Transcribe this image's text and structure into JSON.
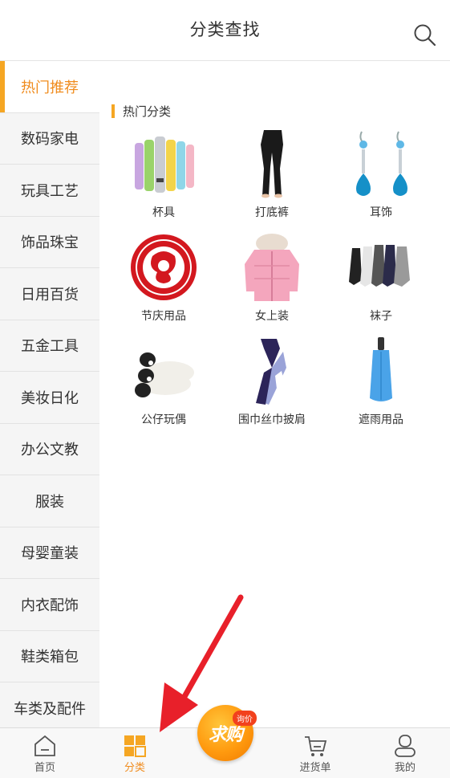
{
  "header": {
    "title": "分类查找"
  },
  "sidebar": {
    "items": [
      {
        "label": "热门推荐",
        "active": true
      },
      {
        "label": "数码家电"
      },
      {
        "label": "玩具工艺"
      },
      {
        "label": "饰品珠宝"
      },
      {
        "label": "日用百货"
      },
      {
        "label": "五金工具"
      },
      {
        "label": "美妆日化"
      },
      {
        "label": "办公文教"
      },
      {
        "label": "服装"
      },
      {
        "label": "母婴童装"
      },
      {
        "label": "内衣配饰"
      },
      {
        "label": "鞋类箱包"
      },
      {
        "label": "车类及配件"
      }
    ]
  },
  "main": {
    "section_title": "热门分类",
    "categories": [
      {
        "label": "杯具",
        "icon": "thermos-bottles-icon"
      },
      {
        "label": "打底裤",
        "icon": "leggings-icon"
      },
      {
        "label": "耳饰",
        "icon": "earrings-icon"
      },
      {
        "label": "节庆用品",
        "icon": "papercut-icon"
      },
      {
        "label": "女上装",
        "icon": "down-jacket-icon"
      },
      {
        "label": "袜子",
        "icon": "socks-icon"
      },
      {
        "label": "公仔玩偶",
        "icon": "plush-dog-icon"
      },
      {
        "label": "围巾丝巾披肩",
        "icon": "scarf-icon"
      },
      {
        "label": "遮雨用品",
        "icon": "umbrella-icon"
      }
    ]
  },
  "bottom_nav": {
    "home": "首页",
    "category": "分类",
    "buy": "求购",
    "buy_badge": "询价",
    "cart": "进货单",
    "mine": "我的"
  },
  "colors": {
    "accent": "#f08c1e",
    "badge": "#f2411d",
    "annotation_arrow": "#e8202a"
  }
}
